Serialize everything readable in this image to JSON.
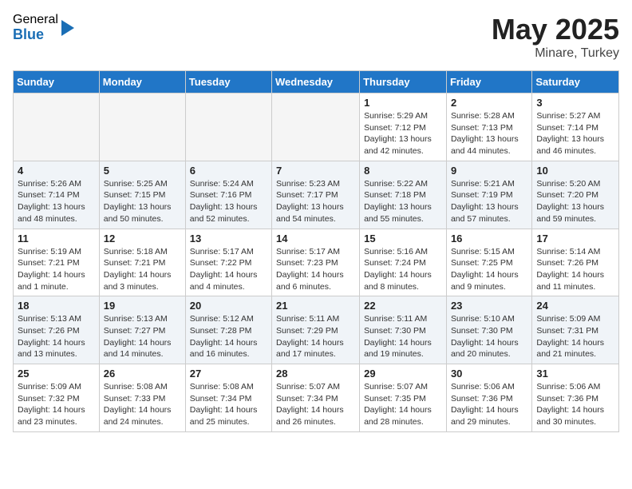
{
  "logo": {
    "general": "General",
    "blue": "Blue"
  },
  "title": "May 2025",
  "location": "Minare, Turkey",
  "weekdays": [
    "Sunday",
    "Monday",
    "Tuesday",
    "Wednesday",
    "Thursday",
    "Friday",
    "Saturday"
  ],
  "weeks": [
    [
      {
        "day": "",
        "info": ""
      },
      {
        "day": "",
        "info": ""
      },
      {
        "day": "",
        "info": ""
      },
      {
        "day": "",
        "info": ""
      },
      {
        "day": "1",
        "info": "Sunrise: 5:29 AM\nSunset: 7:12 PM\nDaylight: 13 hours\nand 42 minutes."
      },
      {
        "day": "2",
        "info": "Sunrise: 5:28 AM\nSunset: 7:13 PM\nDaylight: 13 hours\nand 44 minutes."
      },
      {
        "day": "3",
        "info": "Sunrise: 5:27 AM\nSunset: 7:14 PM\nDaylight: 13 hours\nand 46 minutes."
      }
    ],
    [
      {
        "day": "4",
        "info": "Sunrise: 5:26 AM\nSunset: 7:14 PM\nDaylight: 13 hours\nand 48 minutes."
      },
      {
        "day": "5",
        "info": "Sunrise: 5:25 AM\nSunset: 7:15 PM\nDaylight: 13 hours\nand 50 minutes."
      },
      {
        "day": "6",
        "info": "Sunrise: 5:24 AM\nSunset: 7:16 PM\nDaylight: 13 hours\nand 52 minutes."
      },
      {
        "day": "7",
        "info": "Sunrise: 5:23 AM\nSunset: 7:17 PM\nDaylight: 13 hours\nand 54 minutes."
      },
      {
        "day": "8",
        "info": "Sunrise: 5:22 AM\nSunset: 7:18 PM\nDaylight: 13 hours\nand 55 minutes."
      },
      {
        "day": "9",
        "info": "Sunrise: 5:21 AM\nSunset: 7:19 PM\nDaylight: 13 hours\nand 57 minutes."
      },
      {
        "day": "10",
        "info": "Sunrise: 5:20 AM\nSunset: 7:20 PM\nDaylight: 13 hours\nand 59 minutes."
      }
    ],
    [
      {
        "day": "11",
        "info": "Sunrise: 5:19 AM\nSunset: 7:21 PM\nDaylight: 14 hours\nand 1 minute."
      },
      {
        "day": "12",
        "info": "Sunrise: 5:18 AM\nSunset: 7:21 PM\nDaylight: 14 hours\nand 3 minutes."
      },
      {
        "day": "13",
        "info": "Sunrise: 5:17 AM\nSunset: 7:22 PM\nDaylight: 14 hours\nand 4 minutes."
      },
      {
        "day": "14",
        "info": "Sunrise: 5:17 AM\nSunset: 7:23 PM\nDaylight: 14 hours\nand 6 minutes."
      },
      {
        "day": "15",
        "info": "Sunrise: 5:16 AM\nSunset: 7:24 PM\nDaylight: 14 hours\nand 8 minutes."
      },
      {
        "day": "16",
        "info": "Sunrise: 5:15 AM\nSunset: 7:25 PM\nDaylight: 14 hours\nand 9 minutes."
      },
      {
        "day": "17",
        "info": "Sunrise: 5:14 AM\nSunset: 7:26 PM\nDaylight: 14 hours\nand 11 minutes."
      }
    ],
    [
      {
        "day": "18",
        "info": "Sunrise: 5:13 AM\nSunset: 7:26 PM\nDaylight: 14 hours\nand 13 minutes."
      },
      {
        "day": "19",
        "info": "Sunrise: 5:13 AM\nSunset: 7:27 PM\nDaylight: 14 hours\nand 14 minutes."
      },
      {
        "day": "20",
        "info": "Sunrise: 5:12 AM\nSunset: 7:28 PM\nDaylight: 14 hours\nand 16 minutes."
      },
      {
        "day": "21",
        "info": "Sunrise: 5:11 AM\nSunset: 7:29 PM\nDaylight: 14 hours\nand 17 minutes."
      },
      {
        "day": "22",
        "info": "Sunrise: 5:11 AM\nSunset: 7:30 PM\nDaylight: 14 hours\nand 19 minutes."
      },
      {
        "day": "23",
        "info": "Sunrise: 5:10 AM\nSunset: 7:30 PM\nDaylight: 14 hours\nand 20 minutes."
      },
      {
        "day": "24",
        "info": "Sunrise: 5:09 AM\nSunset: 7:31 PM\nDaylight: 14 hours\nand 21 minutes."
      }
    ],
    [
      {
        "day": "25",
        "info": "Sunrise: 5:09 AM\nSunset: 7:32 PM\nDaylight: 14 hours\nand 23 minutes."
      },
      {
        "day": "26",
        "info": "Sunrise: 5:08 AM\nSunset: 7:33 PM\nDaylight: 14 hours\nand 24 minutes."
      },
      {
        "day": "27",
        "info": "Sunrise: 5:08 AM\nSunset: 7:34 PM\nDaylight: 14 hours\nand 25 minutes."
      },
      {
        "day": "28",
        "info": "Sunrise: 5:07 AM\nSunset: 7:34 PM\nDaylight: 14 hours\nand 26 minutes."
      },
      {
        "day": "29",
        "info": "Sunrise: 5:07 AM\nSunset: 7:35 PM\nDaylight: 14 hours\nand 28 minutes."
      },
      {
        "day": "30",
        "info": "Sunrise: 5:06 AM\nSunset: 7:36 PM\nDaylight: 14 hours\nand 29 minutes."
      },
      {
        "day": "31",
        "info": "Sunrise: 5:06 AM\nSunset: 7:36 PM\nDaylight: 14 hours\nand 30 minutes."
      }
    ]
  ]
}
